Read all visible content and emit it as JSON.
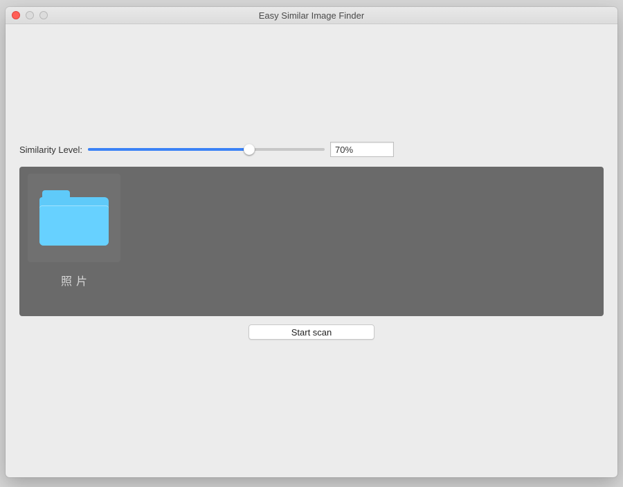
{
  "window": {
    "title": "Easy Similar Image Finder"
  },
  "similarity": {
    "label": "Similarity Level:",
    "percent_text": "70%",
    "percent_value": 70
  },
  "folders": {
    "items": [
      {
        "label": "照片",
        "icon": "folder-icon"
      }
    ]
  },
  "actions": {
    "start_scan_label": "Start scan"
  },
  "colors": {
    "accent": "#3b82f6",
    "panel_bg": "#6a6a6a",
    "folder_blue": "#5fcaf9"
  }
}
